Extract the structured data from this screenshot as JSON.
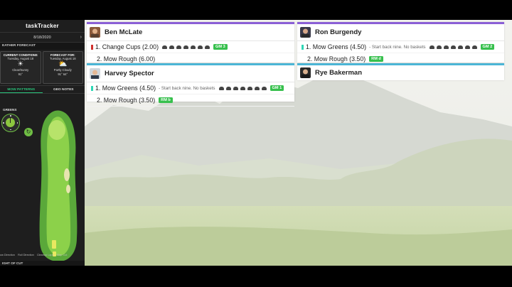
{
  "sidebar": {
    "title": "taskTracker",
    "date": "8/18/2020",
    "next_icon": "chevron-right-icon",
    "weather_section": "EATHER FORECAST",
    "current": {
      "label": "CURRENT CONDITIONS",
      "day": "Tuesday, August 18",
      "cond": "Clear/Sunny",
      "temp": "91°",
      "icon": "sun-icon"
    },
    "forecast": {
      "label": "FORECAST FOR:",
      "day": "Tuesday, August 18",
      "cond": "Partly Cloudy",
      "temp": "91° 64°",
      "icon": "partly-cloudy-icon"
    },
    "tabs": [
      "MOW PATTERNS",
      "GEO NOTES"
    ],
    "greens_label": "GREENS",
    "legend": [
      "ow Direction",
      "Roll Direction",
      "Cleanup Laps",
      "Step Cut"
    ],
    "bottom_section": "IGHT OF CUT"
  },
  "cards": [
    {
      "name": "Ben McLate",
      "accent": "#8a5fd6",
      "tasks": [
        {
          "text": "1. Change Cups (2.00)",
          "mark": "#d0312d",
          "note": "",
          "icons": true,
          "badge": "GM 3"
        },
        {
          "text": "2. Mow Rough (6.00)",
          "mark": "",
          "note": "",
          "icons": false,
          "badge": ""
        }
      ]
    },
    {
      "name": "Ron Burgendy",
      "accent": "#8a5fd6",
      "tasks": [
        {
          "text": "1. Mow Greens (4.50)",
          "mark": "#2fd6b5",
          "note": "- Start back nine. No baskets",
          "icons": true,
          "badge": "GM 2"
        },
        {
          "text": "2. Mow Rough (3.50)",
          "mark": "",
          "note": "",
          "icons": false,
          "badge": "RM d"
        }
      ]
    },
    {
      "name": "Harvey Spector",
      "accent": "#4bb6d6",
      "tasks": [
        {
          "text": "1. Mow Greens (4.50)",
          "mark": "#2fd6b5",
          "note": "- Start back nine. No baskets",
          "icons": true,
          "badge": "GM 1"
        },
        {
          "text": "2. Mow Rough (3.50)",
          "mark": "",
          "note": "",
          "icons": false,
          "badge": "RM b"
        }
      ]
    },
    {
      "name": "Rye Bakerman",
      "accent": "#4bb6d6",
      "tasks": []
    }
  ],
  "colors": {
    "badge": "#37c04d",
    "sidebar": "#1e1e1e",
    "active_tab": "#29c47b"
  }
}
